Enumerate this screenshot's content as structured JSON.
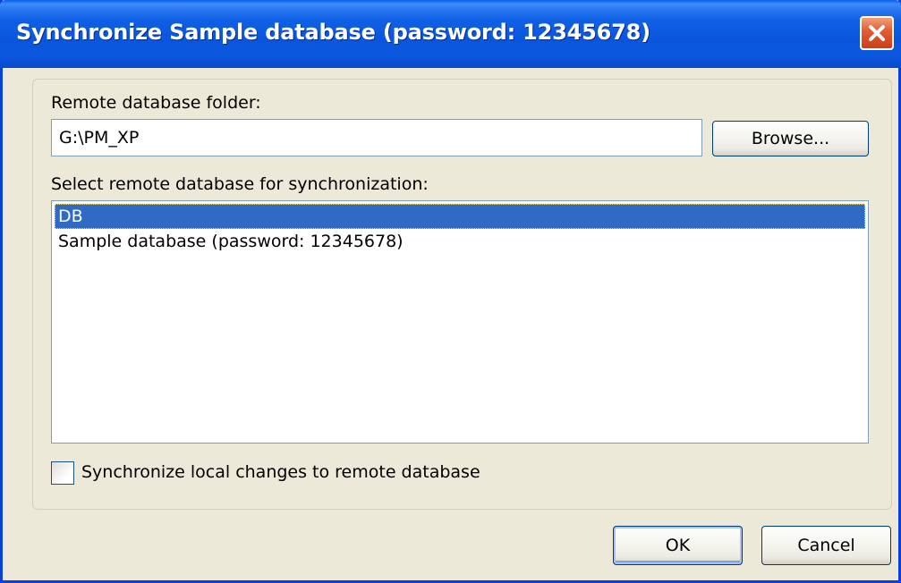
{
  "window": {
    "title": "Synchronize Sample database (password: 12345678)",
    "close_icon": "close-icon"
  },
  "remote_folder": {
    "label": "Remote database folder:",
    "value": "G:\\PM_XP",
    "browse_label": "Browse..."
  },
  "remote_db": {
    "label": "Select remote database for synchronization:",
    "items": [
      {
        "label": "DB",
        "selected": true
      },
      {
        "label": "Sample database (password: 12345678)",
        "selected": false
      }
    ]
  },
  "sync_option": {
    "label": "Synchronize local changes to remote database",
    "checked": false
  },
  "footer": {
    "ok_label": "OK",
    "cancel_label": "Cancel"
  },
  "colors": {
    "title_bar": "#0a55dc",
    "dialog_bg": "#ece9d8",
    "selection": "#316ac5",
    "close_button": "#e2582e"
  }
}
